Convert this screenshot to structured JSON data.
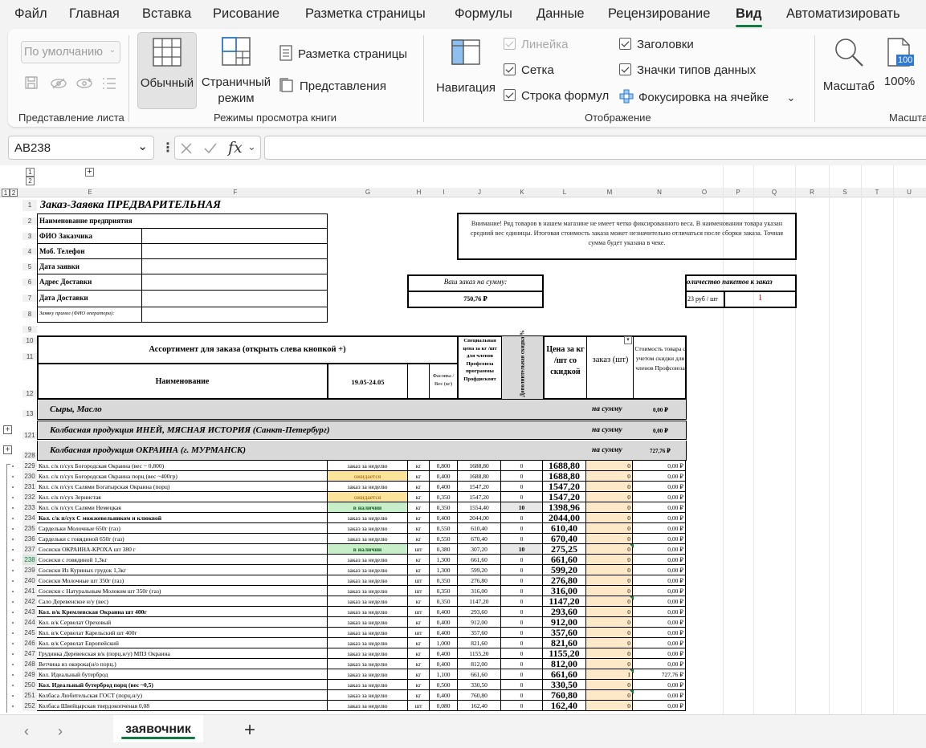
{
  "menu": {
    "tabs": [
      "Файл",
      "Главная",
      "Вставка",
      "Рисование",
      "Разметка страницы",
      "Формулы",
      "Данные",
      "Рецензирование",
      "Вид",
      "Автоматизировать"
    ],
    "active": "Вид"
  },
  "ribbon": {
    "sheet_view": {
      "select_value": "По умолчанию",
      "group_label": "Представление листа"
    },
    "workbook_views": {
      "normal": "Обычный",
      "page_break_line1": "Страничный",
      "page_break_line2": "режим",
      "page_layout": "Разметка страницы",
      "custom_views": "Представления",
      "group_label": "Режимы просмотра книги"
    },
    "show": {
      "navigation": "Навигация",
      "ruler": "Линейка",
      "gridlines": "Сетка",
      "formula_bar": "Строка формул",
      "headings": "Заголовки",
      "data_type_icons": "Значки типов данных",
      "cell_focus": "Фокусировка на ячейке",
      "group_label": "Отображение"
    },
    "zoom": {
      "zoom": "Масштаб",
      "zoom100": "100%",
      "zoom100_badge": "100",
      "group_label": "Масшта"
    }
  },
  "formula_bar": {
    "name_box": "AB238",
    "fx": "fx",
    "value": ""
  },
  "outline": {
    "levels_top": [
      "1",
      "2"
    ],
    "levels_left": [
      "1",
      "2"
    ]
  },
  "columns": [
    "E",
    "F",
    "G",
    "H",
    "I",
    "J",
    "K",
    "L",
    "M",
    "N",
    "O",
    "P",
    "Q",
    "R",
    "S",
    "T",
    "U"
  ],
  "sheet": {
    "title": "Заказ-Заявка ПРЕДВАРИТЕЛЬНАЯ",
    "info_labels": [
      "Наименование предприятия",
      "ФИО Заказчика",
      "Моб. Телефон",
      "Дата заявки",
      "Адрес Доставки",
      "Дата Доставки",
      "Заявку принял (ФИО оператора):"
    ],
    "notice": "Внимание! Ряд товаров в нашем магазине не имеет четко фиксированного веса. В наименовании товара указан средний вес единицы. Итоговая стоимость заказа может незначительно отличаться после сборки заказа. Точная сумма будет указана в чеке.",
    "order_sum_label": "Ваш заказ на сумму:",
    "order_sum_value": "750,76 ₽",
    "packages_label": "оличество пакетов к заказ",
    "package_price": "23 руб / шт",
    "package_count": "1",
    "assortment_header": "Ассортимент для заказа (открыть слева кнопкой +)",
    "col_name": "Наименование",
    "col_dates": "19.05-24.05",
    "col_pack": "Фасовка / Вес (кг)",
    "col_special": "Специальная цена за кг /шт для членов Профсоюза программы Профдисконт",
    "col_extra_disc": "Дополнительная скидка %",
    "col_price": "Цена за кг /шт со скидкой",
    "col_order": "заказ (шт)",
    "col_cost": "Стоимость товара с учетом скидки для членов Профсоюза",
    "groups": [
      {
        "row": "13",
        "name": "Сыры, Масло",
        "sum_label": "на сумму",
        "sum": "0,00 ₽"
      },
      {
        "row": "121",
        "name": "Колбасная продукция ИНЕЙ, МЯСНАЯ ИСТОРИЯ (Санкт-Петербург)",
        "sum_label": "на сумму",
        "sum": "0,00 ₽"
      },
      {
        "row": "228",
        "name": "Колбасная продукция ОКРАИНА (г. МУРМАНСК)",
        "sum_label": "на сумму",
        "sum": "727,76 ₽"
      }
    ],
    "row_labels_top": [
      "1",
      "2",
      "3",
      "4",
      "5",
      "6",
      "7",
      "8",
      "9",
      "10",
      "11",
      "12"
    ],
    "items": [
      {
        "row": "229",
        "name": "Кол. с/к п/сух Богородская Окраина (вес ~ 0,800)",
        "status": "заказ за неделю",
        "unit": "кг",
        "pack": "0,800",
        "special": "1688,80",
        "disc": "0",
        "price": "1688,80",
        "qty": "0",
        "cost": "0,00 ₽"
      },
      {
        "row": "230",
        "name": "Кол. с/к п/сух Богородская Окраина порц (вес ~400гр)",
        "status": "ожидается",
        "unit": "кг",
        "pack": "0,400",
        "special": "1688,80",
        "disc": "0",
        "price": "1688,80",
        "qty": "0",
        "cost": "0,00 ₽"
      },
      {
        "row": "231",
        "name": "Кол. с/к п/сух Салями Богатырская Окраина (порц)",
        "status": "заказ за неделю",
        "unit": "кг",
        "pack": "0,400",
        "special": "1547,20",
        "disc": "0",
        "price": "1547,20",
        "qty": "0",
        "cost": "0,00 ₽"
      },
      {
        "row": "232",
        "name": "Кол. с/к п/сух Зернистая",
        "status": "ожидается",
        "unit": "кг",
        "pack": "0,350",
        "special": "1547,20",
        "disc": "0",
        "price": "1547,20",
        "qty": "0",
        "cost": "0,00 ₽"
      },
      {
        "row": "233",
        "name": "Кол. с/к п/сух Салями Немецкая",
        "status": "в наличии",
        "unit": "кг",
        "pack": "0,350",
        "special": "1554,40",
        "disc": "10",
        "price": "1398,96",
        "qty": "0",
        "cost": "0,00 ₽"
      },
      {
        "row": "234",
        "name": "Кол. с/к п/сух С можжевельником и клюквой",
        "status": "заказ за неделю",
        "unit": "кг",
        "pack": "0,400",
        "special": "2044,00",
        "disc": "0",
        "price": "2044,00",
        "qty": "0",
        "cost": "0,00 ₽"
      },
      {
        "row": "235",
        "name": "Сардельки Молочные 650г (газ)",
        "status": "заказ за неделю",
        "unit": "кг",
        "pack": "0,550",
        "special": "610,40",
        "disc": "0",
        "price": "610,40",
        "qty": "0",
        "cost": "0,00 ₽"
      },
      {
        "row": "236",
        "name": "Сардельки с говядиной 650г (газ)",
        "status": "заказ за неделю",
        "unit": "кг",
        "pack": "0,550",
        "special": "670,40",
        "disc": "0",
        "price": "670,40",
        "qty": "0",
        "cost": "0,00 ₽"
      },
      {
        "row": "237",
        "name": "Сосиски ОКРАИНА-КРОХА шт 380 г",
        "status": "в наличии",
        "unit": "шт",
        "pack": "0,380",
        "special": "307,20",
        "disc": "10",
        "price": "275,25",
        "qty": "0",
        "cost": "0,00 ₽"
      },
      {
        "row": "238",
        "name": "Сосиски с говядиной 1,3кг",
        "status": "заказ за неделю",
        "unit": "кг",
        "pack": "1,300",
        "special": "661,60",
        "disc": "0",
        "price": "661,60",
        "qty": "0",
        "cost": "0,00 ₽"
      },
      {
        "row": "239",
        "name": "Сосиски Из Куриных грудок 1,3кг",
        "status": "заказ за неделю",
        "unit": "кг",
        "pack": "1,300",
        "special": "599,20",
        "disc": "0",
        "price": "599,20",
        "qty": "0",
        "cost": "0,00 ₽"
      },
      {
        "row": "240",
        "name": "Сосиски Молочные шт  350г (газ)",
        "status": "заказ за неделю",
        "unit": "шт",
        "pack": "0,350",
        "special": "276,80",
        "disc": "0",
        "price": "276,80",
        "qty": "0",
        "cost": "0,00 ₽"
      },
      {
        "row": "241",
        "name": "Сосиски с Натуральным Молоком шт  350г (газ)",
        "status": "заказ за неделю",
        "unit": "шт",
        "pack": "0,350",
        "special": "316,00",
        "disc": "0",
        "price": "316,00",
        "qty": "0",
        "cost": "0,00 ₽"
      },
      {
        "row": "242",
        "name": "Сало Деревенское н/у (вес)",
        "status": "заказ за неделю",
        "unit": "кг",
        "pack": "0,350",
        "special": "1147,20",
        "disc": "0",
        "price": "1147,20",
        "qty": "0",
        "cost": "0,00 ₽"
      },
      {
        "row": "243",
        "name": "Кол. в/к Кремлевская Окраина шт 400г",
        "status": "заказ за неделю",
        "unit": "шт",
        "pack": "0,400",
        "special": "293,60",
        "disc": "0",
        "price": "293,60",
        "qty": "0",
        "cost": "0,00 ₽"
      },
      {
        "row": "244",
        "name": "Кол. в/к Сервелат Ореховый",
        "status": "заказ за неделю",
        "unit": "кг",
        "pack": "0,400",
        "special": "912,00",
        "disc": "0",
        "price": "912,00",
        "qty": "0",
        "cost": "0,00 ₽"
      },
      {
        "row": "245",
        "name": "Кол. в/к Сервелат Карельский шт 400г",
        "status": "заказ за неделю",
        "unit": "шт",
        "pack": "0,400",
        "special": "357,60",
        "disc": "0",
        "price": "357,60",
        "qty": "0",
        "cost": "0,00 ₽"
      },
      {
        "row": "246",
        "name": "Кол. в/к Сервелат Европейский",
        "status": "заказ за неделю",
        "unit": "кг",
        "pack": "1,000",
        "special": "821,60",
        "disc": "0",
        "price": "821,60",
        "qty": "0",
        "cost": "0,00 ₽"
      },
      {
        "row": "247",
        "name": "Грудинка Деревенская в/к (порц.н/у) МПЗ Окраина",
        "status": "заказ за неделю",
        "unit": "кг",
        "pack": "0,400",
        "special": "1155,20",
        "disc": "0",
        "price": "1155,20",
        "qty": "0",
        "cost": "0,00 ₽"
      },
      {
        "row": "248",
        "name": "Ветчина из окорока(н/о порц.)",
        "status": "заказ за неделю",
        "unit": "кг",
        "pack": "0,400",
        "special": "812,00",
        "disc": "0",
        "price": "812,00",
        "qty": "0",
        "cost": "0,00 ₽"
      },
      {
        "row": "249",
        "name": "Кол. Идеальный бутерброд",
        "status": "заказ за неделю",
        "unit": "кг",
        "pack": "1,100",
        "special": "661,60",
        "disc": "0",
        "price": "661,60",
        "qty": "1",
        "cost": "727,76 ₽"
      },
      {
        "row": "250",
        "name": "Кол. Идеальный бутерброд порц (вес ~0,5)",
        "status": "заказ за неделю",
        "unit": "кг",
        "pack": "0,500",
        "special": "330,50",
        "disc": "0",
        "price": "330,50",
        "qty": "0",
        "cost": "0,00 ₽"
      },
      {
        "row": "251",
        "name": "Колбаса Любительская ГОСТ (порц.н/у)",
        "status": "заказ за неделю",
        "unit": "кг",
        "pack": "0,400",
        "special": "760,80",
        "disc": "0",
        "price": "760,80",
        "qty": "0",
        "cost": "0,00 ₽"
      },
      {
        "row": "252",
        "name": "Колбаса Швейцарская твердокопченая 0,08",
        "status": "заказ за неделю",
        "unit": "шт",
        "pack": "0,080",
        "special": "162,40",
        "disc": "0",
        "price": "162,40",
        "qty": "0",
        "cost": "0,00 ₽"
      }
    ]
  },
  "sheet_tabs": {
    "active": "заявочник",
    "prev": "‹",
    "next": "›",
    "add": "+"
  }
}
